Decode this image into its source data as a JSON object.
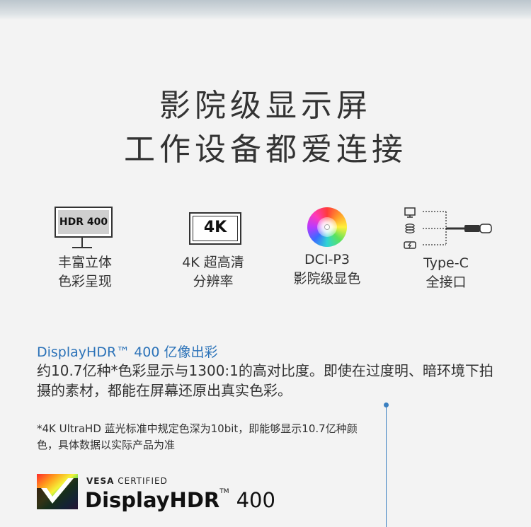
{
  "headline": {
    "line1": "影院级显示屏",
    "line2": "工作设备都爱连接"
  },
  "features": [
    {
      "icon": "hdr-monitor-icon",
      "icon_text": "HDR 400",
      "line1": "丰富立体",
      "line2": "色彩呈现"
    },
    {
      "icon": "4k-icon",
      "icon_text": "4K",
      "line1": "4K 超高清",
      "line2": "分辨率"
    },
    {
      "icon": "color-wheel-icon",
      "line1": "DCI-P3",
      "line2": "影院级显色"
    },
    {
      "icon": "usb-c-connection-icon",
      "line1": "Type-C",
      "line2": "全接口"
    }
  ],
  "hdr_section": {
    "title": "DisplayHDR™ 400 亿像出彩",
    "body": "约10.7亿种*色彩显示与1300:1的高对比度。即使在过度明、暗环境下拍摄的素材，都能在屏幕还原出真实色彩。",
    "note": "*4K UltraHD 蓝光标准中规定色深为10bit，即能够显示10.7亿种颜色，具体数据以实际产品为准"
  },
  "badge": {
    "vesa": "VESA",
    "certified": "CERTIFIED",
    "brand": "DisplayHDR",
    "tm": "TM",
    "level": "400"
  },
  "colors": {
    "accent_blue": "#2b72b8",
    "text": "#333333",
    "background": "#f3f3f3"
  }
}
